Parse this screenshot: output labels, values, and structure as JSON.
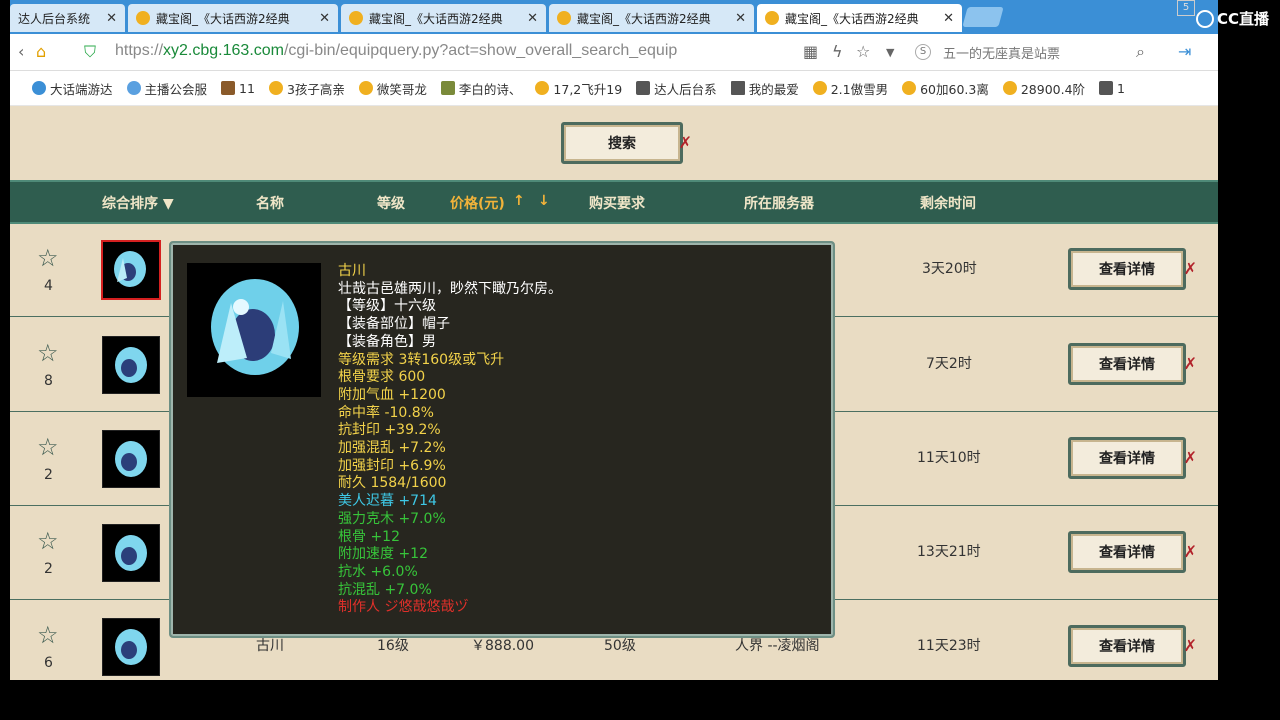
{
  "tabs": [
    {
      "title": "达人后台系统",
      "active": false
    },
    {
      "title": "藏宝阁_《大话西游2经典",
      "active": false
    },
    {
      "title": "藏宝阁_《大话西游2经典",
      "active": false
    },
    {
      "title": "藏宝阁_《大话西游2经典",
      "active": false
    },
    {
      "title": "藏宝阁_《大话西游2经典",
      "active": true
    }
  ],
  "address": {
    "scheme": "https://",
    "host": "xy2.cbg.163.com",
    "path": "/cgi-bin/equipquery.py?act=show_overall_search_equip",
    "search_placeholder": "五一的无座真是站票"
  },
  "bookmarks": [
    "大话端游达",
    "主播公会服",
    "11",
    "3孩子高亲",
    "微笑哥龙",
    "李白的诗、",
    "17,2飞升19",
    "达人后台系",
    "我的最爱",
    "2.1傲雪男",
    "60加60.3离",
    "28900.4阶",
    "1"
  ],
  "search_button": "搜索",
  "table": {
    "headers": {
      "sort": "综合排序 ▼",
      "name": "名称",
      "level": "等级",
      "price": "价格(元)",
      "price_up": "↑",
      "price_down": "↓",
      "requirement": "购买要求",
      "server": "所在服务器",
      "remaining": "剩余时间"
    },
    "rows": [
      {
        "count": "4",
        "time": "3天20时",
        "server_tail": "",
        "button": "查看详情"
      },
      {
        "count": "8",
        "time": "7天2时",
        "server_tail": "",
        "button": "查看详情"
      },
      {
        "count": "2",
        "time": "11天10时",
        "server_tail": "",
        "button": "查看详情"
      },
      {
        "count": "2",
        "time": "13天21时",
        "server_tail": "",
        "button": "查看详情"
      },
      {
        "count": "6",
        "time": "11天23时",
        "name": "古川",
        "level": "16级",
        "price": "￥888.00",
        "req": "50级",
        "server": "人界 --凌烟阁",
        "button": "查看详情"
      }
    ]
  },
  "tooltip": {
    "lines": [
      {
        "text": "古川",
        "color": "#f2d24a"
      },
      {
        "text": "壮哉古邑雄两川，眇然下瞰乃尔房。",
        "color": "#ffffff"
      },
      {
        "text": "【等级】十六级",
        "color": "#ffffff"
      },
      {
        "text": "【装备部位】帽子",
        "color": "#ffffff"
      },
      {
        "text": "【装备角色】男",
        "color": "#ffffff"
      },
      {
        "text": "等级需求 3转160级或飞升",
        "color": "#f2d24a"
      },
      {
        "text": "根骨要求 600",
        "color": "#f2d24a"
      },
      {
        "text": "附加气血 +1200",
        "color": "#f2d24a"
      },
      {
        "text": "命中率 -10.8%",
        "color": "#f2d24a"
      },
      {
        "text": "抗封印 +39.2%",
        "color": "#f2d24a"
      },
      {
        "text": "加强混乱 +7.2%",
        "color": "#f2d24a"
      },
      {
        "text": "加强封印 +6.9%",
        "color": "#f2d24a"
      },
      {
        "text": "耐久 1584/1600",
        "color": "#f2d24a"
      },
      {
        "text": "美人迟暮 +714",
        "color": "#3ec8e6"
      },
      {
        "text": "强力克木 +7.0%",
        "color": "#37c43a"
      },
      {
        "text": "根骨 +12",
        "color": "#37c43a"
      },
      {
        "text": "附加速度 +12",
        "color": "#37c43a"
      },
      {
        "text": "抗水 +6.0%",
        "color": "#37c43a"
      },
      {
        "text": "抗混乱 +7.0%",
        "color": "#37c43a"
      },
      {
        "text": "制作人 ジ悠哉悠哉ヅ",
        "color": "#e0302a"
      }
    ]
  },
  "overlay": {
    "logo": "CC直播",
    "badge": "5"
  }
}
